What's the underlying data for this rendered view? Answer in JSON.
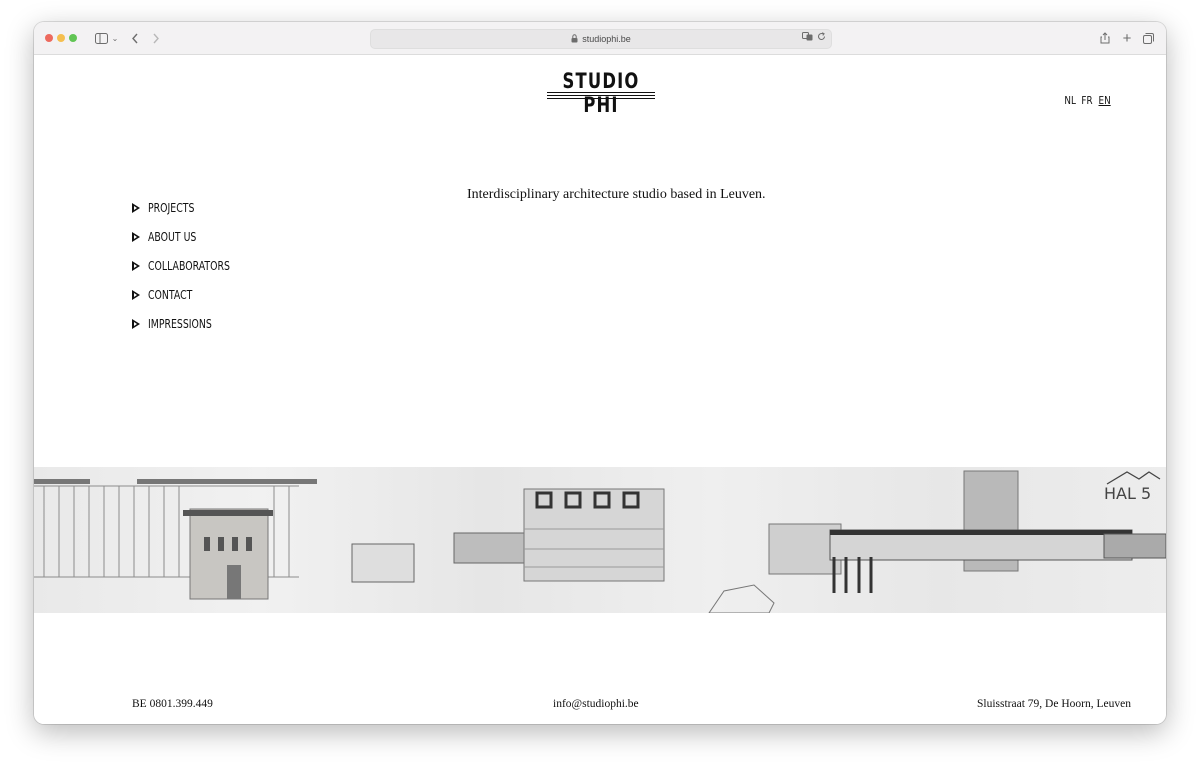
{
  "browser": {
    "url": "studiophi.be"
  },
  "site": {
    "logo": "STUDIO PHI",
    "languages": [
      "NL",
      "FR",
      "EN"
    ],
    "active_language": "EN",
    "nav": [
      "PROJECTS",
      "ABOUT US",
      "COLLABORATORS",
      "CONTACT",
      "IMPRESSIONS"
    ],
    "tagline": "Interdisciplinary architecture studio based in Leuven.",
    "banner_sign": "HAL 5"
  },
  "footer": {
    "vat": "BE 0801.399.449",
    "email": "info@studiophi.be",
    "address": "Sluisstraat 79, De Hoorn, Leuven"
  },
  "colors": {
    "text": "#111111",
    "banner": "#ececec"
  }
}
